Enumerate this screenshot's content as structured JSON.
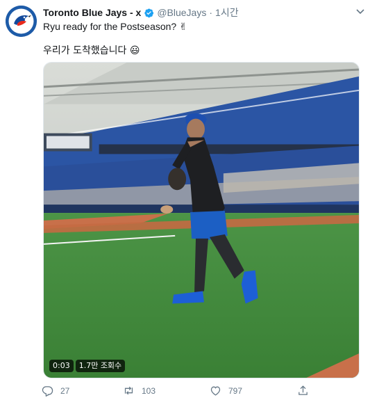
{
  "tweet": {
    "name": "Toronto Blue Jays - x",
    "handle": "@BlueJays",
    "separator": "·",
    "time": "1시간",
    "text_line1": "Ryu ready for the Postseason? ✌",
    "text_line2": "우리가 도착했습니다 😃"
  },
  "video": {
    "duration": "0:03",
    "views": "1.7만 조회수"
  },
  "actions": {
    "reply_count": "27",
    "retweet_count": "103",
    "like_count": "797"
  },
  "colors": {
    "accent": "#1da1f2",
    "muted": "#657786",
    "text": "#14171a",
    "field": "#3f8b3a",
    "stands": "#2a4f9a"
  },
  "icons": [
    "verified-icon",
    "caret-down-icon",
    "reply-icon",
    "retweet-icon",
    "like-icon",
    "share-icon"
  ]
}
